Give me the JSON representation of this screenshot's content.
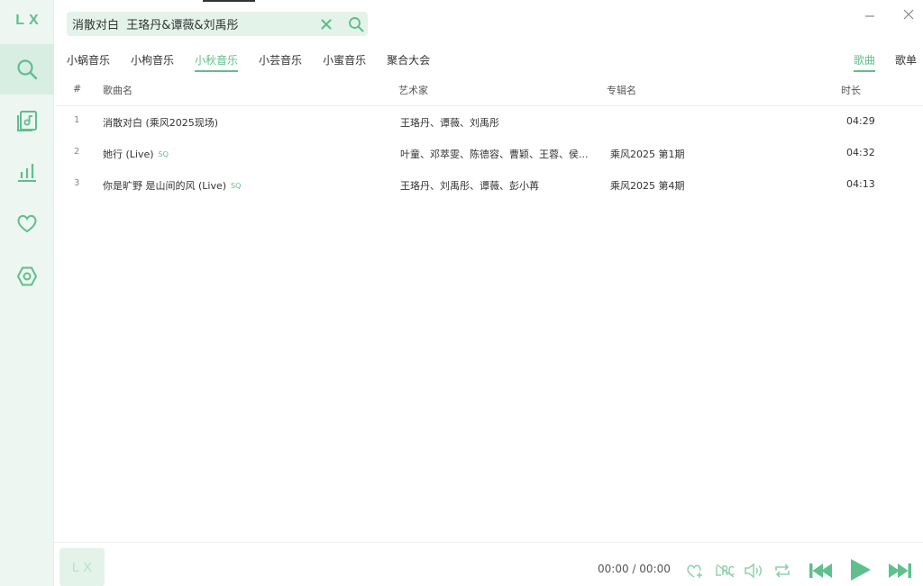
{
  "app": {
    "logo": "LX"
  },
  "sidebar": {
    "items": [
      {
        "name": "search",
        "icon": "search-icon",
        "active": true
      },
      {
        "name": "song-list",
        "icon": "music-list-icon",
        "active": false
      },
      {
        "name": "leaderboard",
        "icon": "chart-icon",
        "active": false
      },
      {
        "name": "favorites",
        "icon": "heart-icon",
        "active": false
      },
      {
        "name": "settings",
        "icon": "settings-icon",
        "active": false
      }
    ]
  },
  "search": {
    "value": "消散对白  王珞丹&谭薇&刘禹彤",
    "clear_icon": "close-icon",
    "search_icon": "search-icon"
  },
  "window": {
    "minimize_icon": "minimize-icon",
    "close_icon": "close-icon"
  },
  "source_tabs": [
    {
      "label": "小蜗音乐",
      "active": false
    },
    {
      "label": "小枸音乐",
      "active": false
    },
    {
      "label": "小秋音乐",
      "active": true
    },
    {
      "label": "小芸音乐",
      "active": false
    },
    {
      "label": "小蜜音乐",
      "active": false
    },
    {
      "label": "聚合大会",
      "active": false
    }
  ],
  "type_tabs": [
    {
      "label": "歌曲",
      "active": true
    },
    {
      "label": "歌单",
      "active": false
    }
  ],
  "table": {
    "columns": {
      "index": "#",
      "name": "歌曲名",
      "artist": "艺术家",
      "album": "专辑名",
      "duration": "时长"
    },
    "rows": [
      {
        "index": "1",
        "name": "消散对白 (乘风2025现场)",
        "badge": "",
        "artist": "王珞丹、谭薇、刘禹彤",
        "album": "",
        "duration": "04:29"
      },
      {
        "index": "2",
        "name": "她行 (Live)",
        "badge": "SQ",
        "artist": "叶童、邓萃雯、陈德容、曹颖、王蓉、侯...",
        "album": "乘风2025 第1期",
        "duration": "04:32"
      },
      {
        "index": "3",
        "name": "你是旷野 是山间的风 (Live)",
        "badge": "SQ",
        "artist": "王珞丹、刘禹彤、谭薇、彭小苒",
        "album": "乘风2025 第4期",
        "duration": "04:13"
      }
    ]
  },
  "player": {
    "cover_text": "LX",
    "current_time": "00:00",
    "separator": "/",
    "total_time": "00:00",
    "controls": [
      "add-favorite-icon",
      "lyrics-icon",
      "volume-icon",
      "repeat-icon",
      "previous-icon",
      "play-icon",
      "next-icon"
    ]
  },
  "colors": {
    "accent": "#5fbf8d",
    "sidebar_bg": "#edf6f1",
    "search_bg": "#e3f3ea"
  }
}
